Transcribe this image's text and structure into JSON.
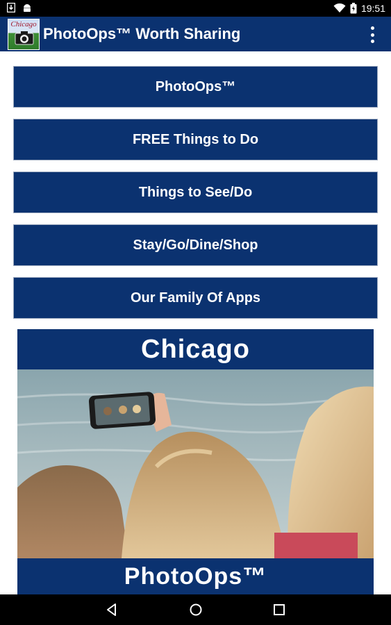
{
  "status_bar": {
    "time": "19:51",
    "left_icons": [
      "download-notification-icon",
      "android-notification-icon"
    ],
    "right_icons": [
      "wifi-icon",
      "battery-icon"
    ]
  },
  "app_bar": {
    "logo_text": "Chicago",
    "title": "PhotoOps™ Worth Sharing",
    "overflow_icon": "more-vertical-icon"
  },
  "menu": {
    "items": [
      {
        "label": "PhotoOps™"
      },
      {
        "label": "FREE Things to Do"
      },
      {
        "label": "Things to See/Do"
      },
      {
        "label": "Stay/Go/Dine/Shop"
      },
      {
        "label": "Our Family Of Apps"
      }
    ]
  },
  "promo": {
    "top_text": "Chicago",
    "bottom_text": "PhotoOps™"
  },
  "nav_bar": {
    "buttons": [
      "back-icon",
      "home-icon",
      "recents-icon"
    ]
  },
  "colors": {
    "primary": "#0b3270",
    "button_border": "#9aa7bd",
    "status_bar": "#000000"
  }
}
